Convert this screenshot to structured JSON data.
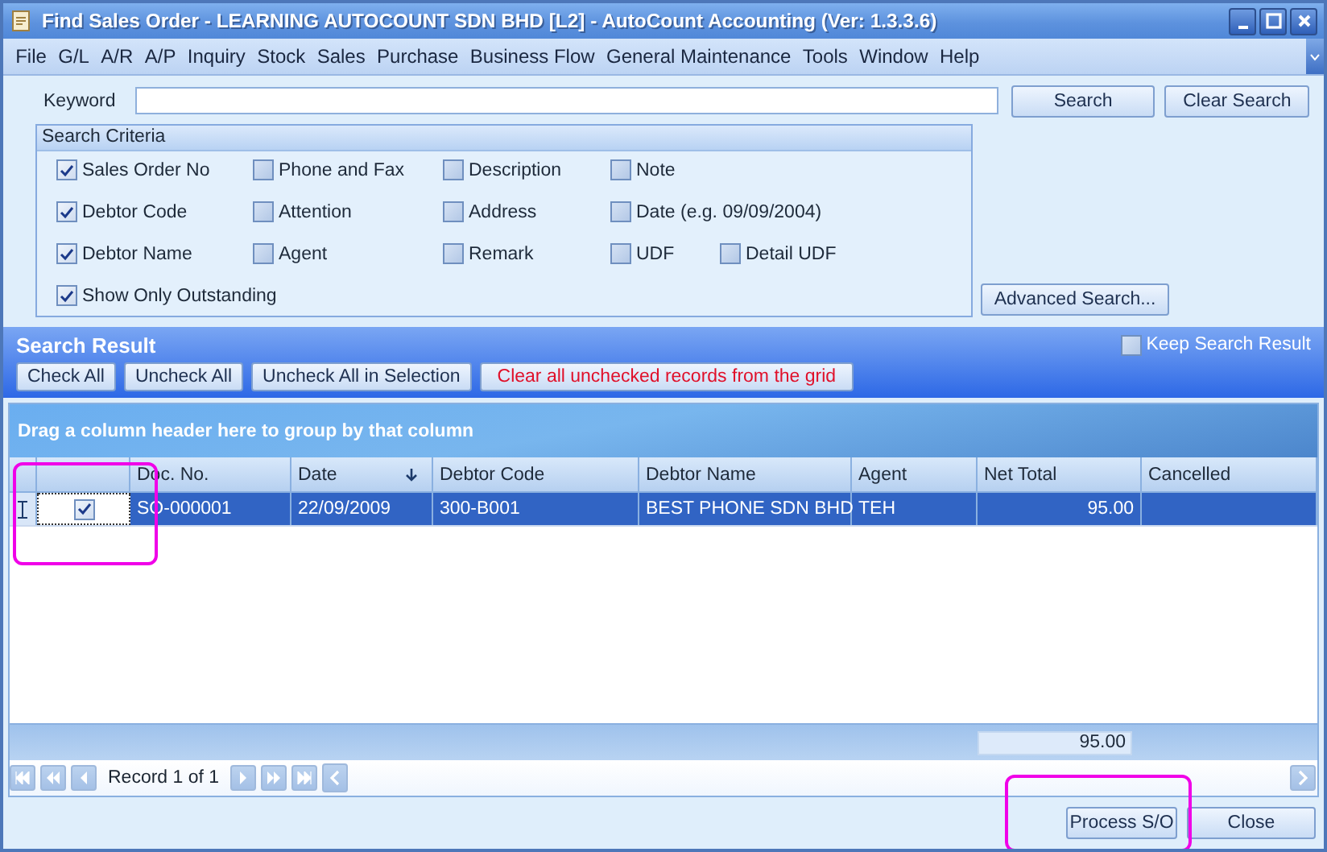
{
  "window": {
    "title": "Find Sales Order - LEARNING AUTOCOUNT SDN BHD [L2] - AutoCount Accounting (Ver: 1.3.3.6)"
  },
  "menu": [
    "File",
    "G/L",
    "A/R",
    "A/P",
    "Inquiry",
    "Stock",
    "Sales",
    "Purchase",
    "Business Flow",
    "General Maintenance",
    "Tools",
    "Window",
    "Help"
  ],
  "keyword": {
    "label": "Keyword"
  },
  "search_buttons": [
    "Search",
    "Clear Search"
  ],
  "criteria": {
    "title": "Search Criteria",
    "rows": [
      [
        {
          "label": "Sales Order No",
          "checked": true
        },
        {
          "label": "Phone and Fax",
          "checked": false
        },
        {
          "label": "Description",
          "checked": false
        },
        {
          "label": "Note",
          "checked": false
        }
      ],
      [
        {
          "label": "Debtor Code",
          "checked": true
        },
        {
          "label": "Attention",
          "checked": false
        },
        {
          "label": "Address",
          "checked": false
        },
        {
          "label": "Date (e.g. 09/09/2004)",
          "checked": false
        }
      ],
      [
        {
          "label": "Debtor Name",
          "checked": true
        },
        {
          "label": "Agent",
          "checked": false
        },
        {
          "label": "Remark",
          "checked": false
        },
        {
          "label": "UDF",
          "checked": false
        },
        {
          "label": "Detail UDF",
          "checked": false
        }
      ],
      [
        {
          "label": "Show Only Outstanding",
          "checked": true
        }
      ]
    ]
  },
  "advanced_search": "Advanced Search...",
  "result": {
    "title": "Search Result",
    "keep": {
      "label": "Keep Search Result",
      "checked": false
    },
    "buttons": [
      {
        "label": "Check All",
        "kind": "normal"
      },
      {
        "label": "Uncheck All",
        "kind": "normal"
      },
      {
        "label": "Uncheck All in Selection",
        "kind": "normal"
      },
      {
        "label": "Clear all unchecked records from the grid",
        "kind": "warning"
      }
    ]
  },
  "grid": {
    "group_hint": "Drag a column header here to group by that column",
    "columns": [
      {
        "label": "Doc. No.",
        "sorted": false
      },
      {
        "label": "Date",
        "sorted": true
      },
      {
        "label": "Debtor Code",
        "sorted": false
      },
      {
        "label": "Debtor Name",
        "sorted": false
      },
      {
        "label": "Agent",
        "sorted": false
      },
      {
        "label": "Net Total",
        "sorted": false
      },
      {
        "label": "Cancelled",
        "sorted": false
      }
    ],
    "rows": [
      {
        "checked": true,
        "selected": true,
        "cells": [
          "SO-000001",
          "22/09/2009",
          "300-B001",
          "BEST PHONE SDN BHD",
          "TEH",
          "95.00",
          ""
        ]
      }
    ],
    "total": "95.00",
    "navigator": "Record 1 of 1"
  },
  "bottom_buttons": [
    "Process S/O",
    "Close"
  ]
}
